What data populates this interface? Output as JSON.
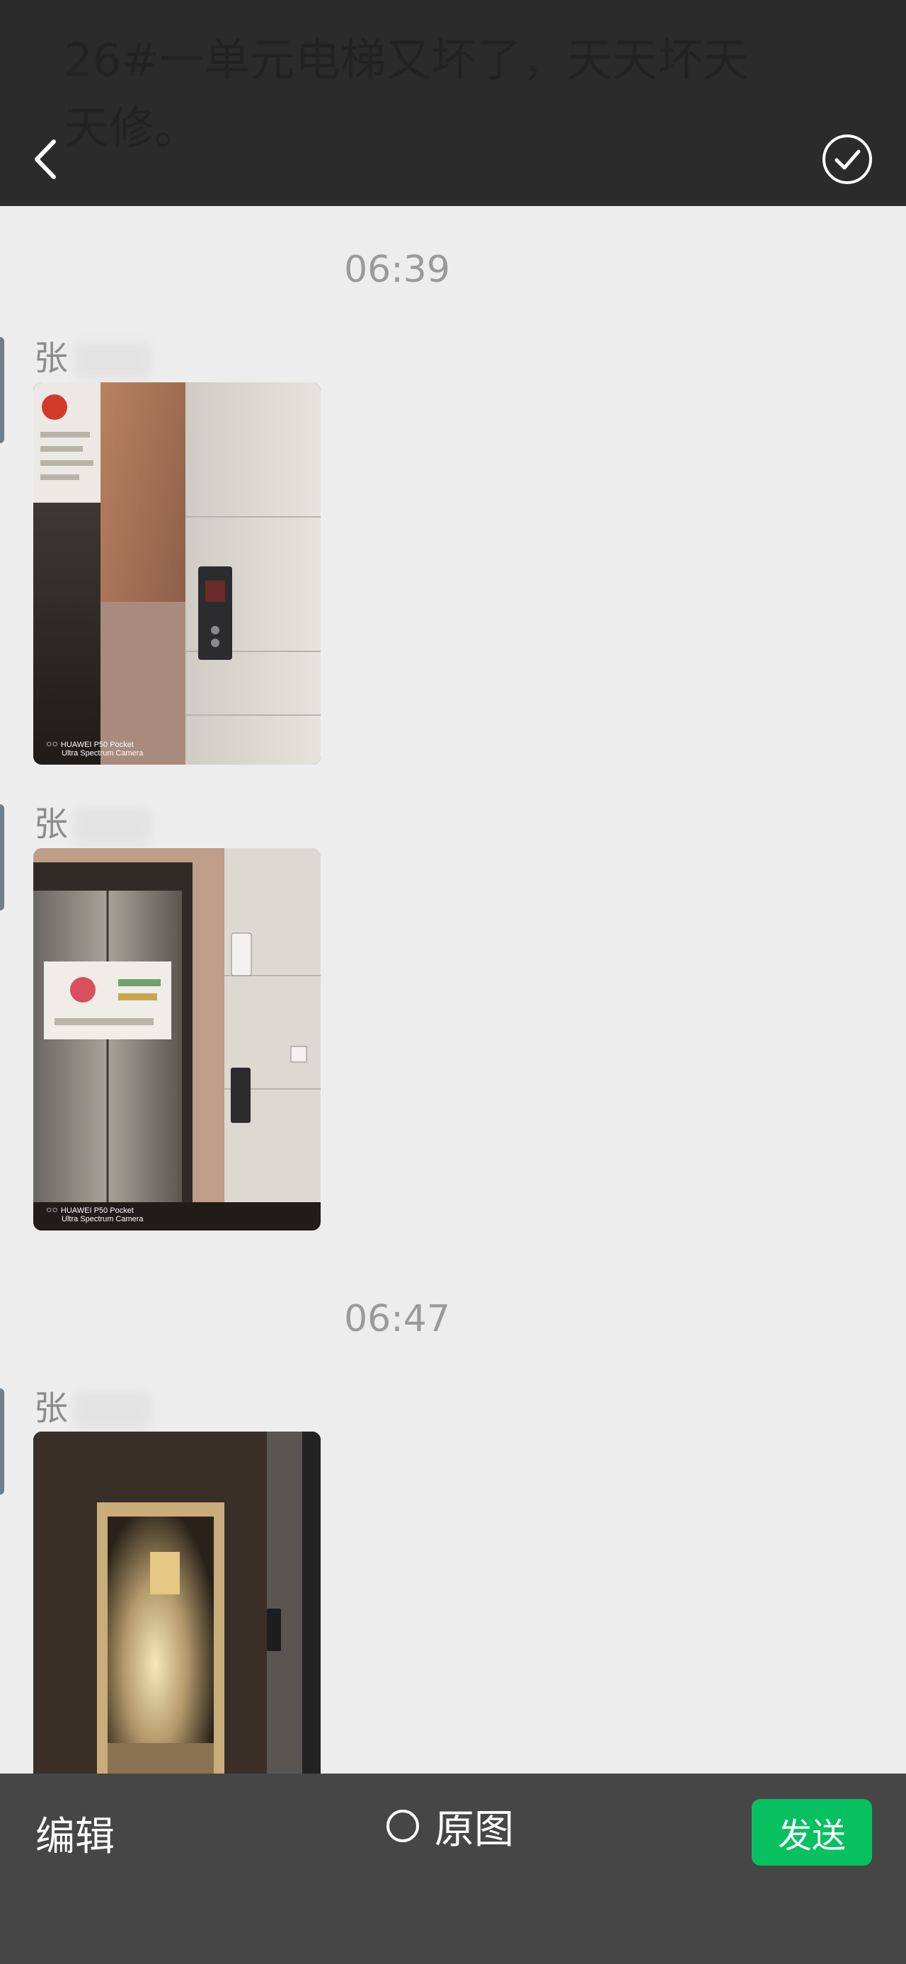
{
  "header": {
    "background_text": "26#一单元电梯又坏了，天天坏天天修。"
  },
  "messages": [
    {
      "timestamp": "06:39",
      "items": [
        {
          "sender_initial": "张",
          "photo_caption_brand": "HUAWEI P50 Pocket",
          "photo_caption_sub": "Ultra Spectrum Camera"
        },
        {
          "sender_initial": "张",
          "photo_caption_brand": "HUAWEI P50 Pocket",
          "photo_caption_sub": "Ultra Spectrum Camera"
        }
      ]
    },
    {
      "timestamp": "06:47",
      "items": [
        {
          "sender_initial": "张"
        }
      ]
    }
  ],
  "footer": {
    "edit_label": "编辑",
    "original_label": "原图",
    "send_label": "发送"
  },
  "colors": {
    "send_green": "#07c160",
    "top_bar": "#2b2b2b",
    "bottom_bar": "#464646",
    "chat_bg": "#ededed"
  }
}
